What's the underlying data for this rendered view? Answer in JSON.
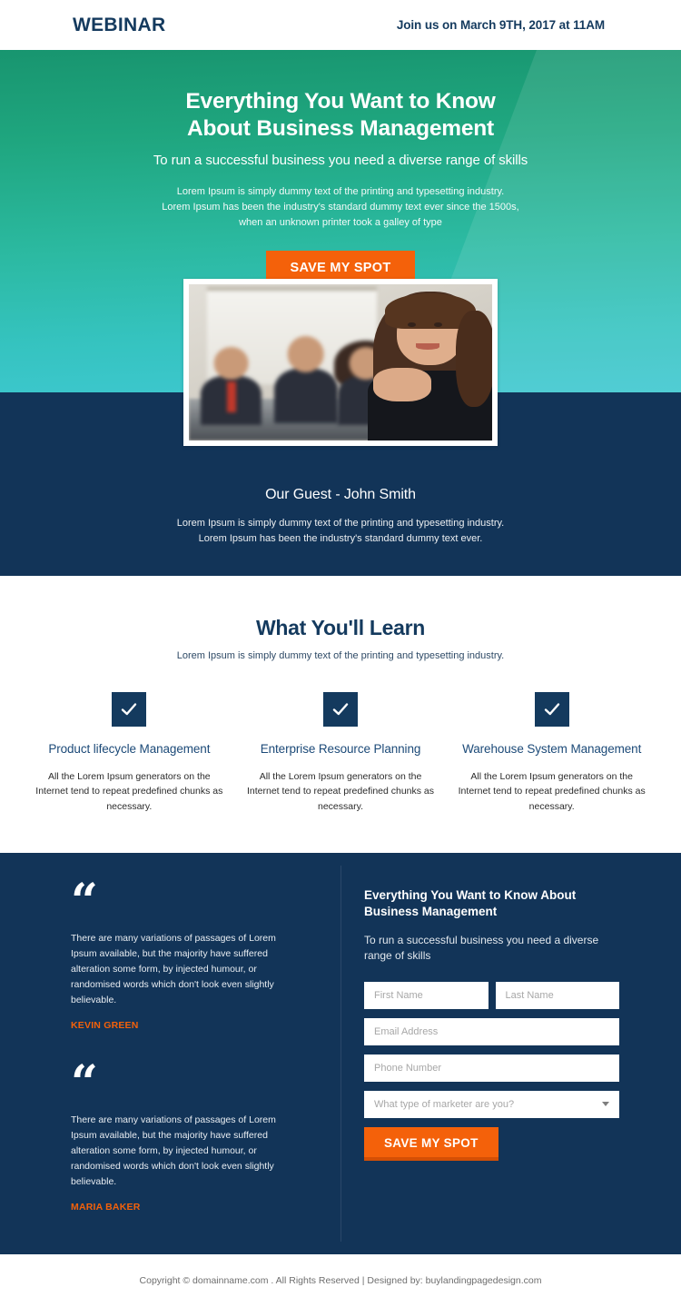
{
  "topbar": {
    "brand": "WEBINAR",
    "date_text": "Join  us on March 9TH, 2017 at 11AM"
  },
  "hero": {
    "heading_line1": "Everything You Want to Know",
    "heading_line2": "About Business Management",
    "subheading": "To run a successful business you need a diverse range of skills",
    "paragraph_line1": "Lorem Ipsum is simply dummy text of the printing and typesetting industry.",
    "paragraph_line2": "Lorem Ipsum has been the industry's standard dummy text ever since the 1500s,",
    "paragraph_line3": "when an unknown printer took a galley of type",
    "cta_label": "SAVE MY SPOT",
    "photo_alt": "business team meeting with smiling woman in foreground"
  },
  "guest": {
    "title": "Our Guest - John Smith",
    "paragraph_line1": "Lorem Ipsum is simply dummy text of the printing and typesetting industry.",
    "paragraph_line2": "Lorem Ipsum has been the industry's standard dummy text ever."
  },
  "learn": {
    "heading": "What You'll Learn",
    "subheading": "Lorem Ipsum is simply dummy text of the printing and typesetting industry.",
    "cards": [
      {
        "icon": "check-icon",
        "title": "Product lifecycle Management",
        "text": "All the Lorem Ipsum generators on the Internet tend to repeat predefined chunks as necessary."
      },
      {
        "icon": "check-icon",
        "title": "Enterprise Resource Planning",
        "text": "All the Lorem Ipsum generators on the Internet tend to repeat predefined chunks as necessary."
      },
      {
        "icon": "check-icon",
        "title": "Warehouse System Management",
        "text": "All the Lorem Ipsum generators on the Internet tend to repeat predefined chunks as necessary."
      }
    ]
  },
  "testimonials": [
    {
      "quote_mark": "“",
      "text": "There are many variations of passages of Lorem Ipsum available, but the majority have suffered alteration some form, by injected humour, or randomised words which don't look even slightly believable.",
      "author": "KEVIN GREEN"
    },
    {
      "quote_mark": "“",
      "text": "There are many variations of passages of Lorem Ipsum available, but the majority have suffered alteration some form, by injected humour, or randomised words which don't look even slightly believable.",
      "author": "MARIA BAKER"
    }
  ],
  "form": {
    "title": "Everything You Want to Know About Business Management",
    "subtitle": "To run a successful business you need a diverse range of skills",
    "first_name_placeholder": "First Name",
    "first_name_value": "",
    "last_name_placeholder": "Last Name",
    "last_name_value": "",
    "email_placeholder": "Email Address",
    "email_value": "",
    "phone_placeholder": "Phone Number",
    "phone_value": "",
    "marketer_select_label": "What type of marketer are you?",
    "marketer_select_icon": "chevron-down-icon",
    "submit_label": "SAVE MY SPOT"
  },
  "footer": {
    "text": "Copyright © domainname.com . All Rights Reserved | Designed by: buylandingpagedesign.com"
  },
  "colors": {
    "navy": "#123458",
    "navy_text": "#143a5e",
    "orange": "#f4610a",
    "orange_shadow": "#d44f05",
    "teal_top": "#18956f",
    "teal_bottom": "#3ec8d0",
    "white": "#ffffff"
  }
}
